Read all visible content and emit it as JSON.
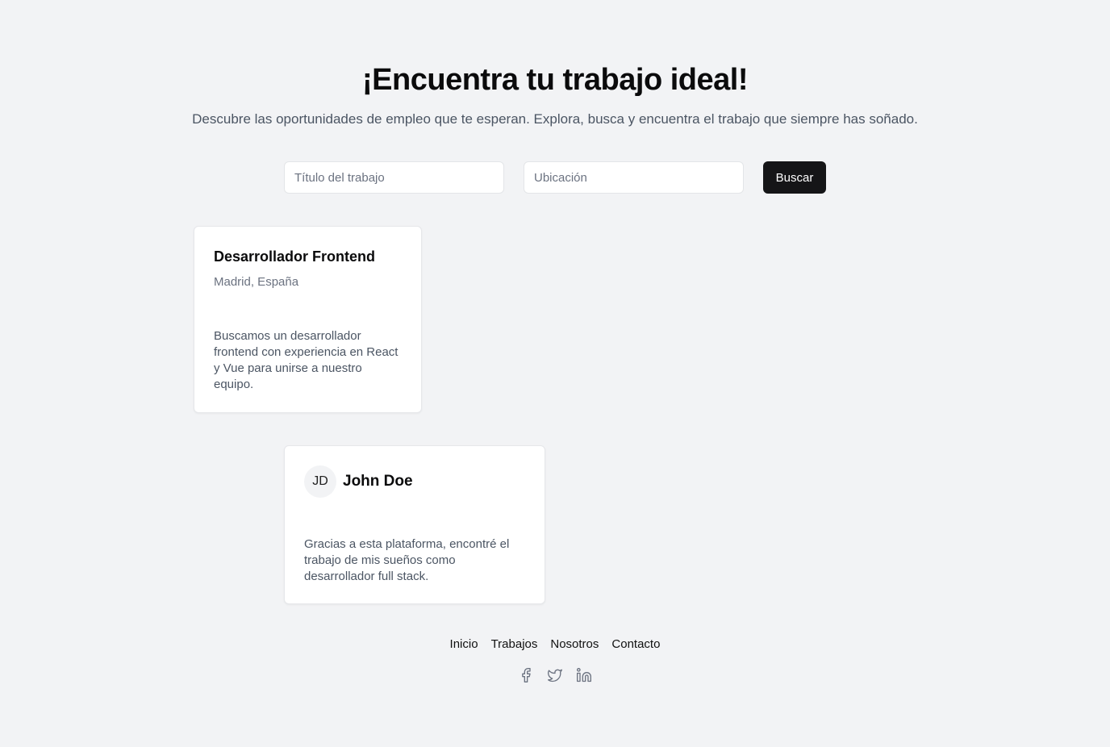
{
  "hero": {
    "title": "¡Encuentra tu trabajo ideal!",
    "subtitle": "Descubre las oportunidades de empleo que te esperan. Explora, busca y encuentra el trabajo que siempre has soñado."
  },
  "search": {
    "title_placeholder": "Título del trabajo",
    "title_value": "",
    "location_placeholder": "Ubicación",
    "location_value": "",
    "button_label": "Buscar"
  },
  "jobs": [
    {
      "title": "Desarrollador Frontend",
      "location": "Madrid, España",
      "description": "Buscamos un desarrollador frontend con experiencia en React y Vue para unirse a nuestro equipo."
    }
  ],
  "testimonials": [
    {
      "initials": "JD",
      "name": "John Doe",
      "text": "Gracias a esta plataforma, encontré el trabajo de mis sueños como desarrollador full stack."
    }
  ],
  "footer": {
    "links": [
      "Inicio",
      "Trabajos",
      "Nosotros",
      "Contacto"
    ],
    "social_icons": [
      "facebook-icon",
      "twitter-icon",
      "linkedin-icon"
    ]
  },
  "colors": {
    "background": "#f2f3f5",
    "button": "#151517",
    "muted_text": "#6b7280"
  }
}
